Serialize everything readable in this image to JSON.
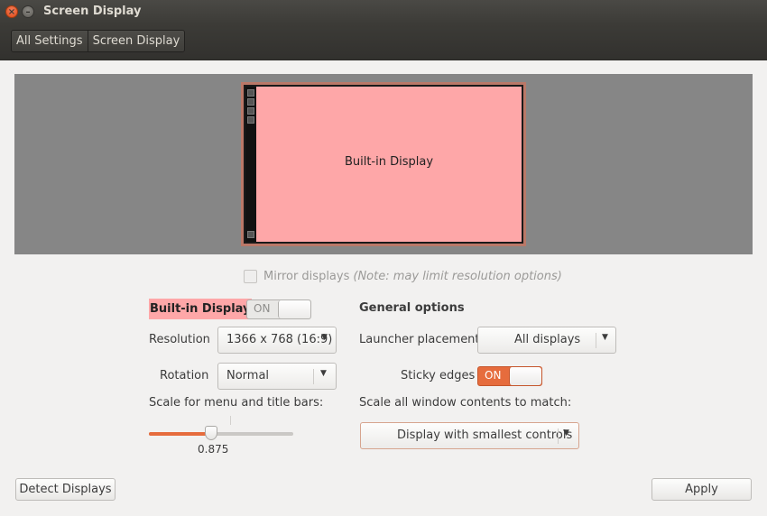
{
  "window": {
    "title": "Screen Display"
  },
  "breadcrumbs": [
    "All Settings",
    "Screen Display"
  ],
  "preview": {
    "monitor_label": "Built-in Display"
  },
  "mirror": {
    "label": "Mirror displays",
    "note": "(Note: may limit resolution options)",
    "checked": false
  },
  "display": {
    "name": "Built-in Display",
    "toggle_label": "ON",
    "resolution_label": "Resolution",
    "resolution_value": "1366 x 768 (16:9)",
    "rotation_label": "Rotation",
    "rotation_value": "Normal",
    "scale_label": "Scale for menu and title bars:",
    "scale_value": "0.875",
    "scale_fraction": 0.43
  },
  "general": {
    "heading": "General options",
    "launcher_label": "Launcher placement",
    "launcher_value": "All displays",
    "sticky_label": "Sticky edges",
    "sticky_toggle": "ON",
    "scale_all_label": "Scale all window contents to match:",
    "scale_all_value": "Display with smallest controls"
  },
  "buttons": {
    "detect": "Detect Displays",
    "apply": "Apply"
  },
  "colors": {
    "accent": "#e66c3d",
    "monitor_fill": "#fea7a8"
  }
}
